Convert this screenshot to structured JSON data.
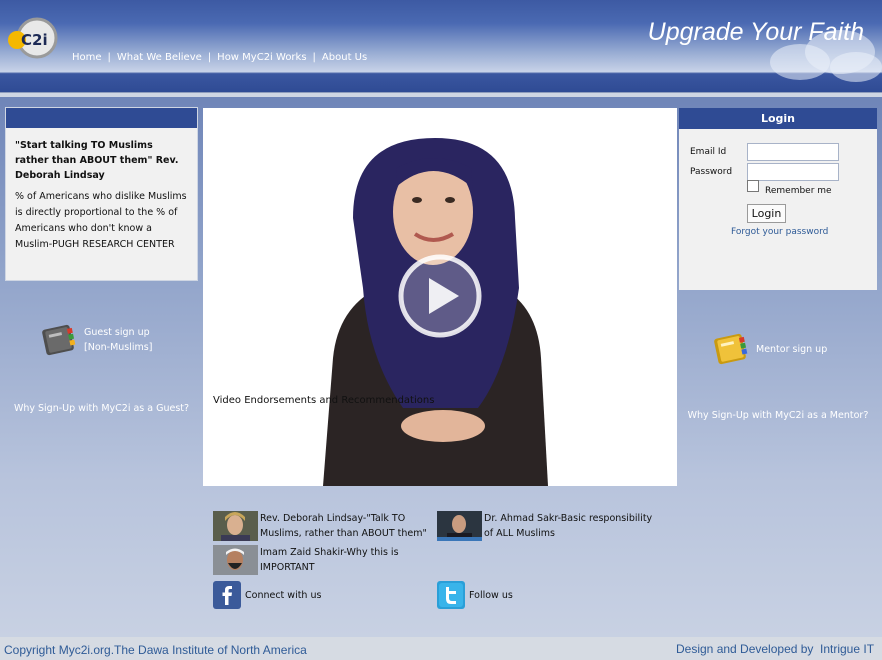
{
  "header": {
    "logo_text": "C2i",
    "tagline": "Upgrade Your Faith",
    "nav": [
      "Home",
      "What We Believe",
      "How MyC2i Works",
      "About Us"
    ],
    "nav_separator": "|"
  },
  "left_panel": {
    "quote": "\"Start talking TO Muslims rather than ABOUT them\" Rev. Deborah Lindsay",
    "fact": "% of Americans who dislike Muslims is directly proportional to the % of Americans who don't know a Muslim-PUGH RESEARCH CENTER",
    "guest_signup_line1": "Guest sign up",
    "guest_signup_line2": "[Non-Muslims]",
    "why_guest": "Why Sign-Up with MyC2i as a Guest?"
  },
  "video": {
    "play_icon": "play-icon"
  },
  "login": {
    "title": "Login",
    "email_label": "Email Id",
    "email_value": "",
    "password_label": "Password",
    "password_value": "",
    "remember_label": "Remember me",
    "remember_checked": false,
    "login_button": "Login",
    "forgot_link": "Forgot your password"
  },
  "right_panel": {
    "mentor_signup": "Mentor sign up",
    "why_mentor": "Why Sign-Up with MyC2i as a Mentor?"
  },
  "endorsements": {
    "title": "Video Endorsements and Recommendations",
    "items": [
      {
        "line1": "Rev. Deborah Lindsay-\"Talk TO",
        "line2": "Muslims, rather than ABOUT them\""
      },
      {
        "line1": "Dr. Ahmad Sakr-Basic responsibility",
        "line2": "of ALL Muslims"
      },
      {
        "line1": "Imam Zaid Shakir-Why this is",
        "line2": "IMPORTANT"
      }
    ]
  },
  "social": {
    "facebook": "Connect with us",
    "twitter": "Follow us"
  },
  "footer": {
    "copyright": "Copyright Myc2i.org.The Dawa Institute of North America",
    "credit_prefix": "Design and Developed by",
    "credit_link": "Intrigue IT"
  },
  "colors": {
    "header_blue": "#2f4b94",
    "link_blue": "#2f5b97"
  }
}
